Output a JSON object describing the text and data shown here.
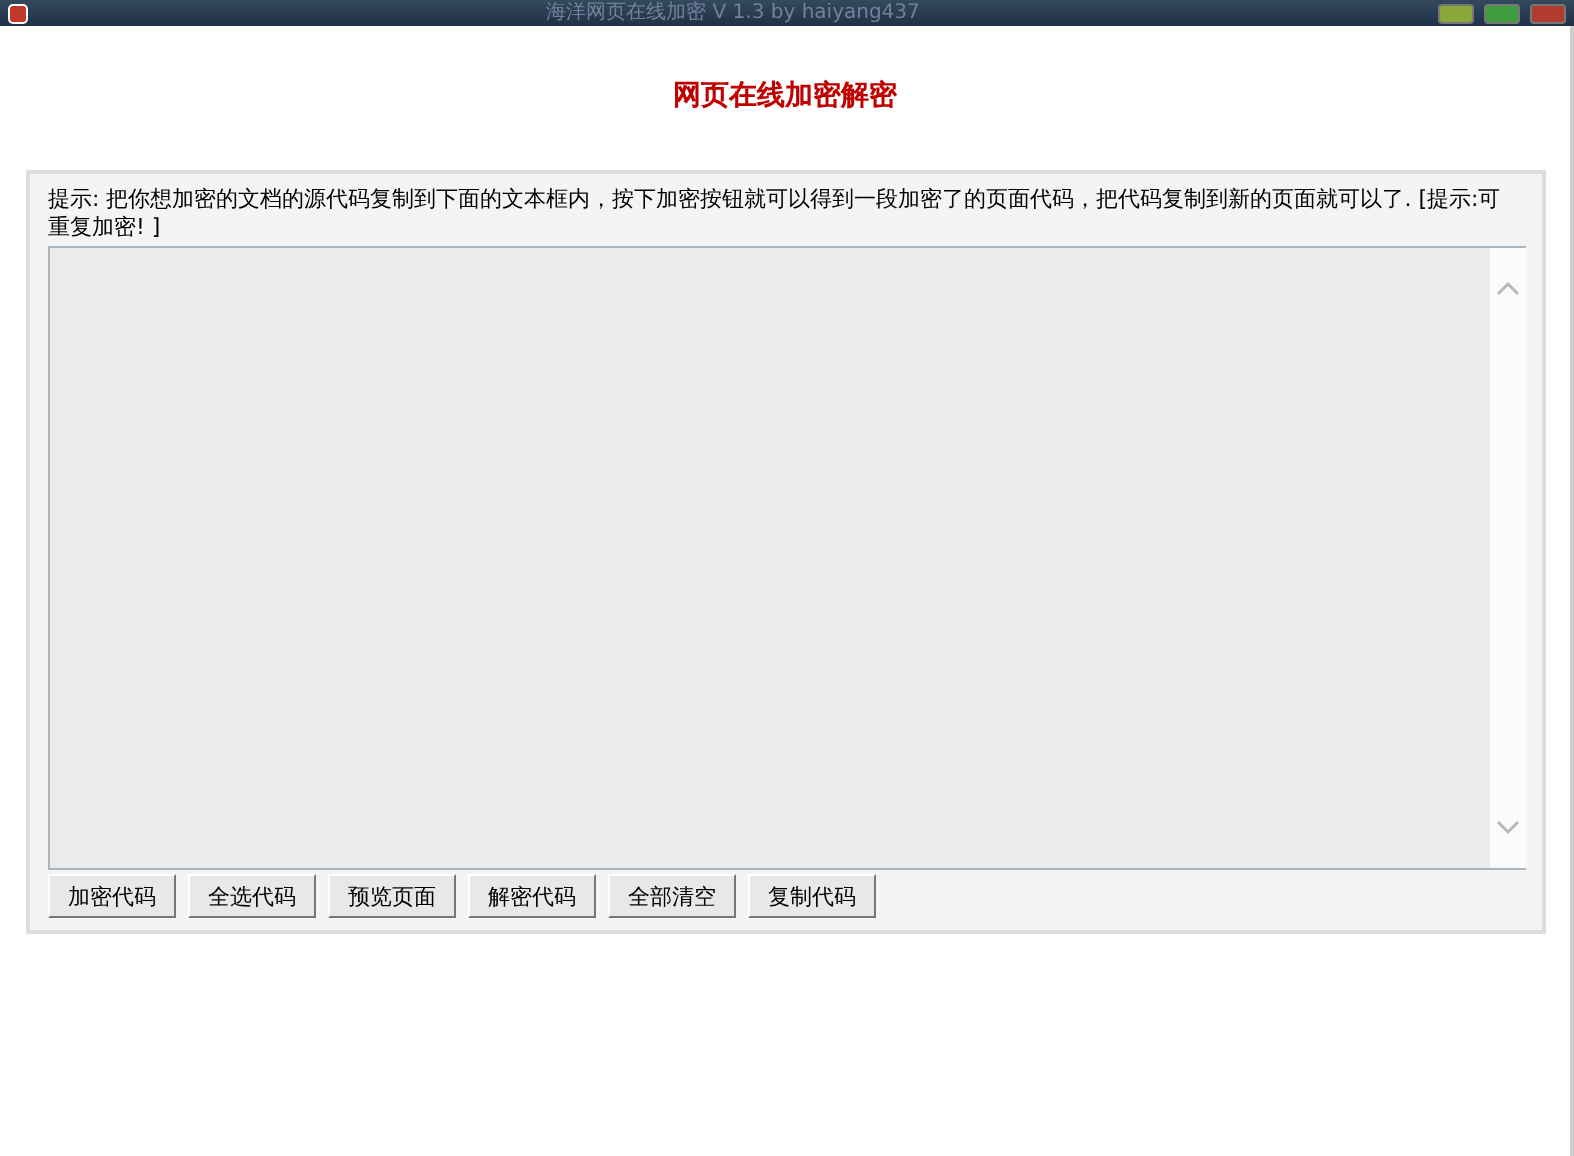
{
  "window": {
    "title": "海洋网页在线加密 V 1.3 by haiyang437"
  },
  "heading": "网页在线加密解密",
  "hint": "提示: 把你想加密的文档的源代码复制到下面的文本框内，按下加密按钮就可以得到一段加密了的页面代码，把代码复制到新的页面就可以了. [提示:可重复加密! ]",
  "buttons": [
    "加密代码",
    "全选代码",
    "预览页面",
    "解密代码",
    "全部清空",
    "复制代码"
  ]
}
